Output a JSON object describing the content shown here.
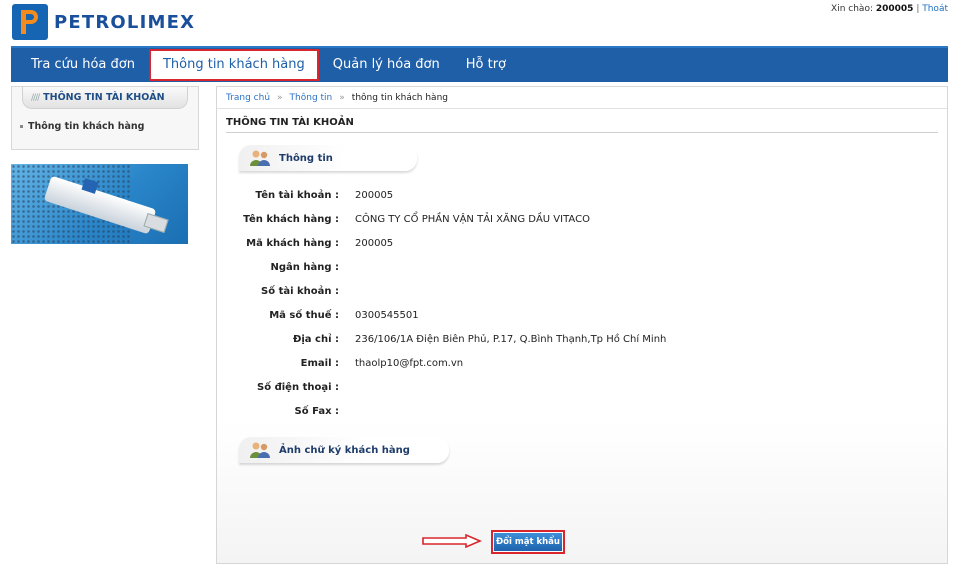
{
  "header": {
    "logo_text": "PETROLIMEX",
    "greeting_label": "Xin chào:",
    "username": "200005",
    "separator": "|",
    "logout": "Thoát"
  },
  "nav": {
    "items": [
      {
        "label": "Tra cứu hóa đơn",
        "active": false
      },
      {
        "label": "Thông tin khách hàng",
        "active": true
      },
      {
        "label": "Quản lý hóa đơn",
        "active": false
      },
      {
        "label": "Hỗ trợ",
        "active": false
      }
    ]
  },
  "sidebar": {
    "title": "THÔNG TIN TÀI KHOẢN",
    "link": "Thông tin khách hàng"
  },
  "breadcrumb": {
    "home": "Trang chủ",
    "info": "Thông tin",
    "current": "thông tin khách hàng",
    "separator": "»"
  },
  "main": {
    "section_title": "THÔNG TIN TÀI KHOẢN",
    "info_tab": "Thông tin",
    "signature_tab": "Ảnh chữ ký khách hàng",
    "fields": [
      {
        "label": "Tên tài khoản :",
        "value": "200005"
      },
      {
        "label": "Tên khách hàng :",
        "value": "CÔNG TY CỔ PHẦN VẬN TẢI XĂNG DẦU VITACO"
      },
      {
        "label": "Mã khách hàng :",
        "value": "200005"
      },
      {
        "label": "Ngân hàng :",
        "value": ""
      },
      {
        "label": "Số tài khoản :",
        "value": ""
      },
      {
        "label": "Mã số thuế :",
        "value": "0300545501"
      },
      {
        "label": "Địa chỉ :",
        "value": "236/106/1A Điện Biên Phủ, P.17, Q.Bình Thạnh,Tp Hồ Chí Minh"
      },
      {
        "label": "Email :",
        "value": "thaolp10@fpt.com.vn"
      },
      {
        "label": "Số điện thoại :",
        "value": ""
      },
      {
        "label": "Số Fax :",
        "value": ""
      }
    ],
    "change_password": "Đổi mật khẩu"
  },
  "colors": {
    "nav_bg": "#1f5fa8",
    "highlight": "#d8262c",
    "link": "#2a73c4"
  }
}
